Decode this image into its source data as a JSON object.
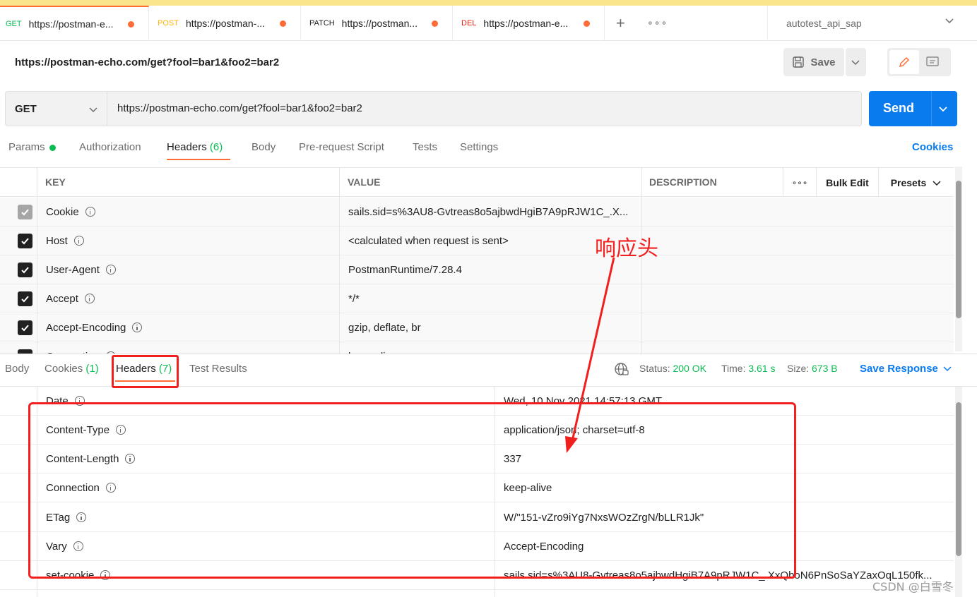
{
  "tabs": [
    {
      "method": "GET",
      "url": "https://postman-e..."
    },
    {
      "method": "POST",
      "url": "https://postman-..."
    },
    {
      "method": "PATCH",
      "url": "https://postman..."
    },
    {
      "method": "DEL",
      "url": "https://postman-e..."
    }
  ],
  "environment": "autotest_api_sap",
  "request_title": "https://postman-echo.com/get?fool=bar1&foo2=bar2",
  "toolbar": {
    "save_label": "Save"
  },
  "request": {
    "method": "GET",
    "url": "https://postman-echo.com/get?fool=bar1&foo2=bar2",
    "send_label": "Send"
  },
  "request_tabs": {
    "params": "Params",
    "authorization": "Authorization",
    "headers": "Headers",
    "headers_count": "(6)",
    "body": "Body",
    "prerequest": "Pre-request Script",
    "tests": "Tests",
    "settings": "Settings",
    "cookies_link": "Cookies"
  },
  "request_headers_table": {
    "col_key": "KEY",
    "col_value": "VALUE",
    "col_description": "DESCRIPTION",
    "more": "∘∘∘",
    "bulk_edit": "Bulk Edit",
    "presets": "Presets",
    "rows": [
      {
        "key": "Cookie",
        "value": "sails.sid=s%3AU8-Gvtreas8o5ajbwdHgiB7A9pRJW1C_.X..."
      },
      {
        "key": "Host",
        "value": "<calculated when request is sent>"
      },
      {
        "key": "User-Agent",
        "value": "PostmanRuntime/7.28.4"
      },
      {
        "key": "Accept",
        "value": "*/*"
      },
      {
        "key": "Accept-Encoding",
        "value": "gzip, deflate, br"
      },
      {
        "key": "Connection",
        "value": "keep-alive"
      }
    ]
  },
  "response_tabs": {
    "body": "Body",
    "cookies": "Cookies",
    "cookies_count": "(1)",
    "headers": "Headers",
    "headers_count": "(7)",
    "test_results": "Test Results"
  },
  "response_status": {
    "status_label": "Status:",
    "status_value": "200 OK",
    "time_label": "Time:",
    "time_value": "3.61 s",
    "size_label": "Size:",
    "size_value": "673 B",
    "save_response": "Save Response"
  },
  "response_headers": [
    {
      "key": "Date",
      "value": "Wed, 10 Nov 2021 14:57:13 GMT"
    },
    {
      "key": "Content-Type",
      "value": "application/json; charset=utf-8"
    },
    {
      "key": "Content-Length",
      "value": "337"
    },
    {
      "key": "Connection",
      "value": "keep-alive"
    },
    {
      "key": "ETag",
      "value": "W/\"151-vZro9iYg7NxsWOzZrgN/bLLR1Jk\""
    },
    {
      "key": "Vary",
      "value": "Accept-Encoding"
    },
    {
      "key": "set-cookie",
      "value": "sails.sid=s%3AU8-Gvtreas8o5ajbwdHgiB7A9pRJW1C_.XxQboN6PnSoSaYZaxOqL150fk..."
    }
  ],
  "annotation": {
    "label": "响应头"
  },
  "watermark": "CSDN @白雪冬",
  "colors": {
    "accent": "#ff6c37",
    "send": "#097bed",
    "success": "#0cbb52",
    "annotation": "#f21f1f"
  }
}
